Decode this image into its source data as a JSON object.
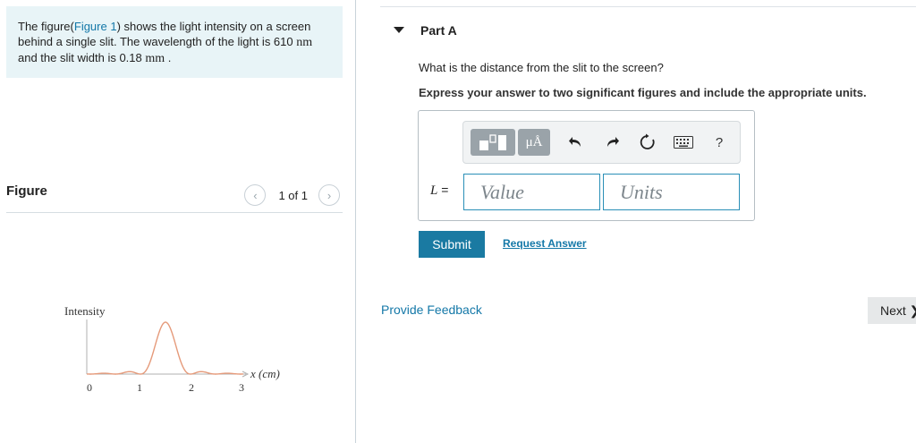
{
  "problem": {
    "text_1": "The figure(",
    "figure_link": "Figure 1",
    "text_2": ") shows the light intensity on a screen behind a single slit. The wavelength of the light is 610 ",
    "unit_wavelength": "nm",
    "text_3": " and the slit width is 0.18 ",
    "unit_width": "mm",
    "text_4": " ."
  },
  "figure_panel": {
    "title": "Figure",
    "pager_text": "1 of 1",
    "prev_icon": "chevron-left-icon",
    "next_icon": "chevron-right-icon"
  },
  "figure": {
    "y_label": "Intensity",
    "x_label": "x (cm)",
    "x_ticks": [
      "0",
      "1",
      "2",
      "3"
    ],
    "curve_color": "#e59a7a",
    "axis_color": "#b0b0b0"
  },
  "part": {
    "title": "Part A",
    "collapse_icon": "caret-down-icon",
    "question": "What is the distance from the slit to the screen?",
    "instruction": "Express your answer to two significant figures and include the appropriate units."
  },
  "toolbar": {
    "units_label": "μÅ",
    "undo_icon": "undo-icon",
    "redo_icon": "redo-icon",
    "reset_icon": "reset-icon",
    "keyboard_icon": "keyboard-icon",
    "help_label": "?"
  },
  "answer": {
    "var_symbol": "L",
    "equals": " =",
    "value_placeholder": "Value",
    "units_placeholder": "Units"
  },
  "actions": {
    "submit_label": "Submit",
    "request_label": "Request Answer",
    "feedback_label": "Provide Feedback",
    "next_label": "Next ❯"
  },
  "colors": {
    "accent": "#1a7aa2",
    "link": "#1478a8",
    "problem_bg": "#e8f4f7"
  }
}
